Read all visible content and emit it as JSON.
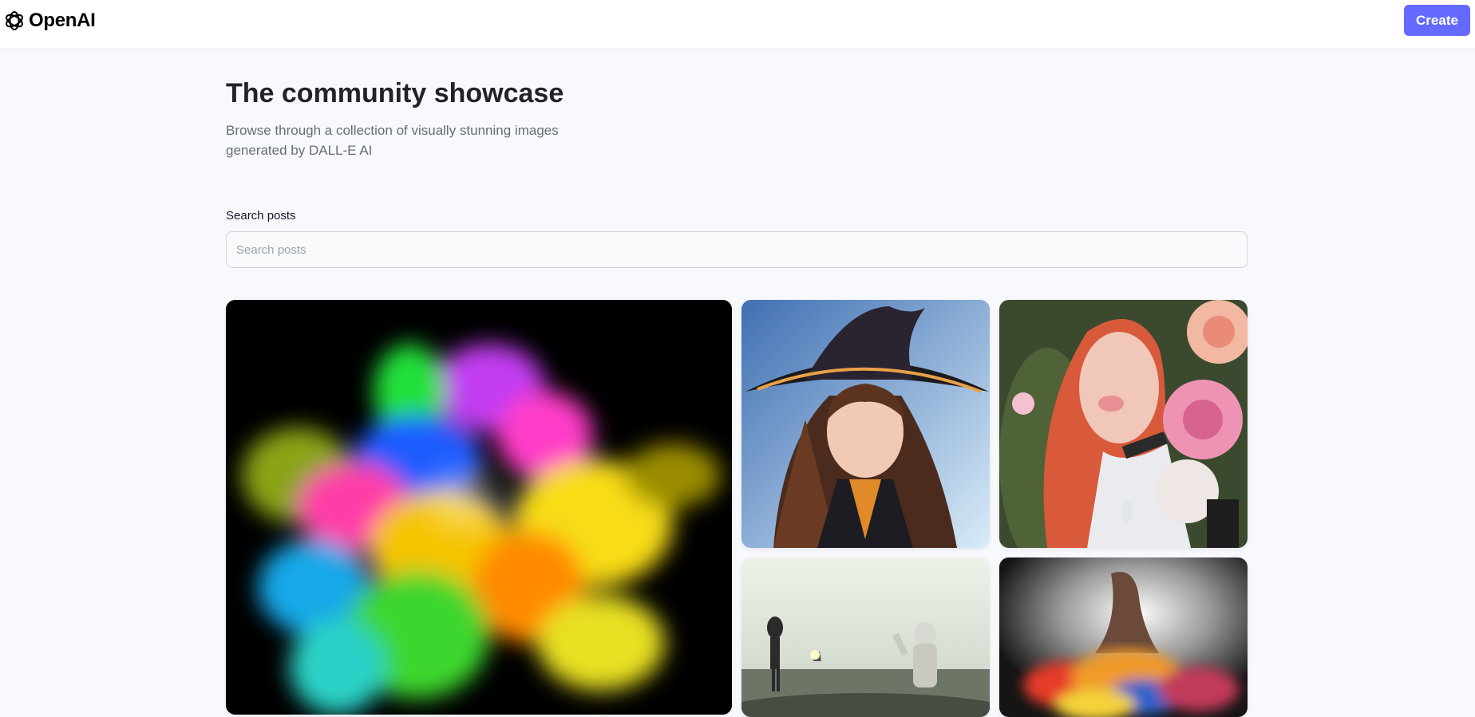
{
  "header": {
    "logo_text": "OpenAI",
    "create_label": "Create"
  },
  "hero": {
    "title": "The community showcase",
    "subtitle": "Browse through a collection of visually stunning images generated by DALL-E AI"
  },
  "search": {
    "label": "Search posts",
    "placeholder": "Search posts",
    "value": ""
  },
  "gallery": {
    "posts": [
      {
        "subject": "colorful powder explosion"
      },
      {
        "subject": "witch girl with hat"
      },
      {
        "subject": "red-haired woman with roses"
      },
      {
        "subject": "alien and astronaut"
      },
      {
        "subject": "dancer with colorful smoke"
      }
    ]
  },
  "colors": {
    "accent": "#6469ff",
    "background": "#f8f9fd",
    "title": "#222328",
    "subtitle": "#666e75"
  }
}
